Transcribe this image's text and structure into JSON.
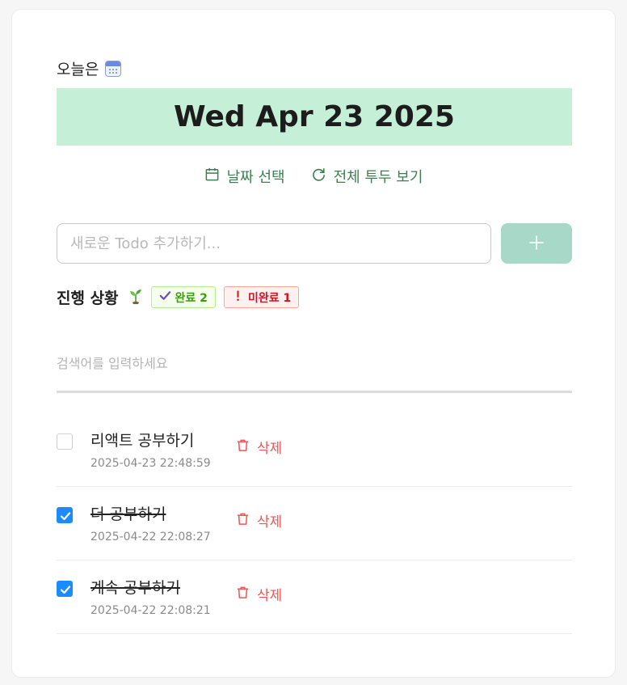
{
  "header": {
    "today_label": "오늘은",
    "calendar_emoji": "calendar-emoji",
    "date": "Wed Apr 23 2025"
  },
  "date_actions": {
    "select_date": "날짜 선택",
    "view_all": "전체 투두 보기"
  },
  "new_todo": {
    "placeholder": "새로운 Todo 추가하기...",
    "value": "",
    "add_icon": "plus-icon"
  },
  "progress": {
    "label": "진행 상황",
    "done_badge": "완료 2",
    "undone_badge": "미완료 1",
    "sprout_emoji": "seedling-emoji"
  },
  "search": {
    "placeholder": "검색어를 입력하세요",
    "value": ""
  },
  "todos": [
    {
      "text": "리액트 공부하기",
      "time": "2025-04-23 22:48:59",
      "done": false,
      "delete_label": "삭제"
    },
    {
      "text": "더 공부하기",
      "time": "2025-04-22 22:08:27",
      "done": true,
      "delete_label": "삭제"
    },
    {
      "text": "계속 공부하기",
      "time": "2025-04-22 22:08:21",
      "done": true,
      "delete_label": "삭제"
    }
  ],
  "colors": {
    "date_banner_bg": "#c6efd8",
    "accent_green": "#3f7e53",
    "add_button_bg": "#a8d9c8",
    "checkbox_checked": "#1a8cff",
    "delete_red": "#f05656"
  }
}
